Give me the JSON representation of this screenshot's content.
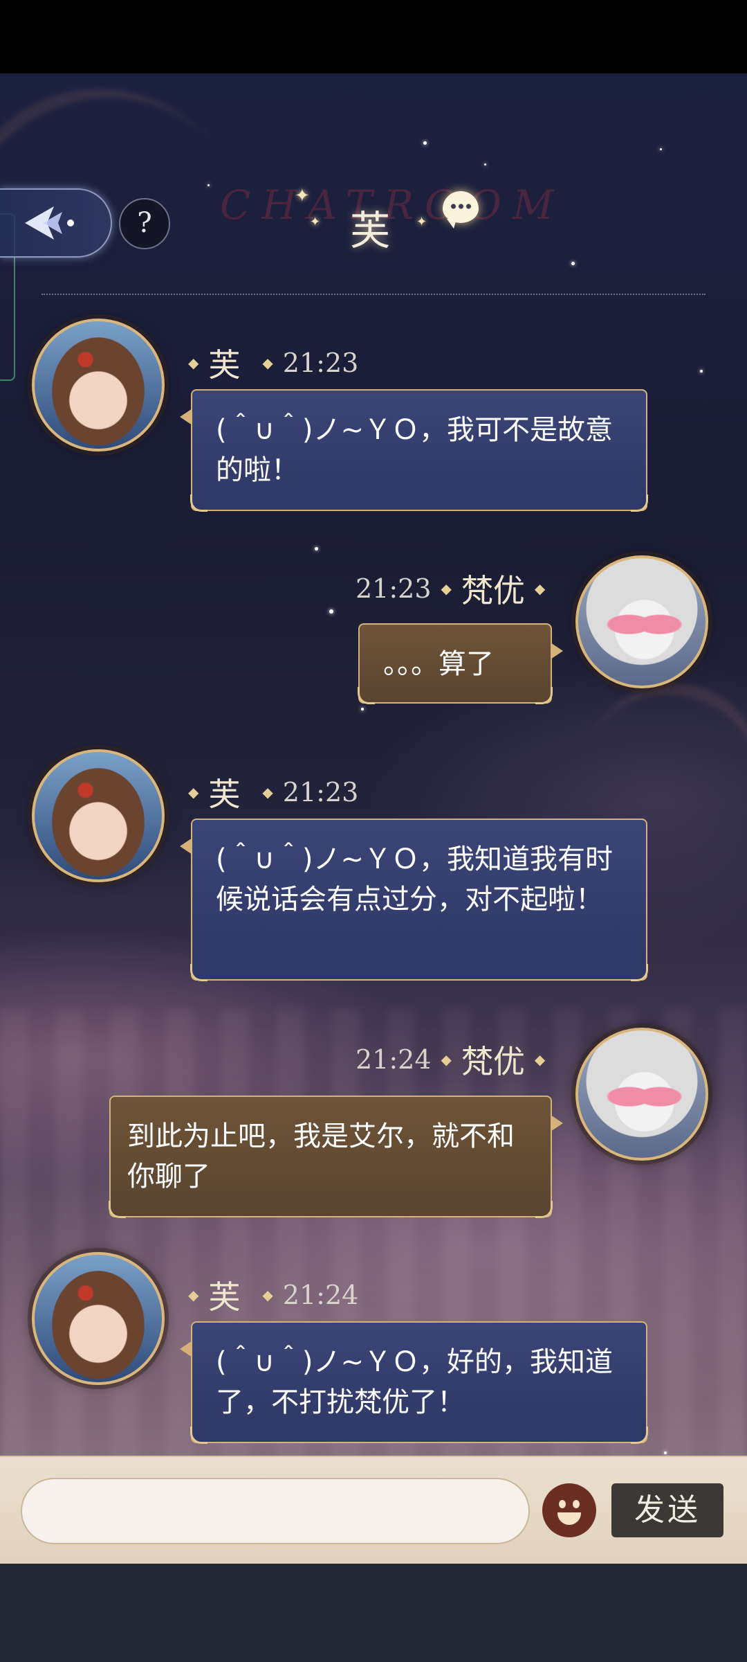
{
  "header": {
    "title": "芙",
    "background_text": "CHATROOM",
    "help_label": "?"
  },
  "messages": [
    {
      "sender": "芙",
      "time": "21:23",
      "side": "left",
      "text": "(＾∪＾)ノ~ＹＯ，我可不是故意的啦！"
    },
    {
      "sender": "梵优",
      "time": "21:23",
      "side": "right",
      "text": "。。。算了"
    },
    {
      "sender": "芙",
      "time": "21:23",
      "side": "left",
      "text": "(＾∪＾)ノ~ＹＯ，我知道我有时候说话会有点过分，对不起啦！"
    },
    {
      "sender": "梵优",
      "time": "21:24",
      "side": "right",
      "text": "到此为止吧，我是艾尔，就不和你聊了"
    },
    {
      "sender": "芙",
      "time": "21:24",
      "side": "left",
      "text": "(＾∪＾)ノ~ＹＯ，好的，我知道了，不打扰梵优了！"
    }
  ],
  "input": {
    "placeholder": "",
    "value": ""
  },
  "send_label": "发送",
  "icons": [
    "back-icon",
    "help-icon",
    "chat-bubble-icon",
    "emoji-icon"
  ],
  "colors": {
    "bubble_left": "#343e6e",
    "bubble_right": "#654c35",
    "gold_border": "#d4b27a",
    "send_button": "#3c3835"
  }
}
